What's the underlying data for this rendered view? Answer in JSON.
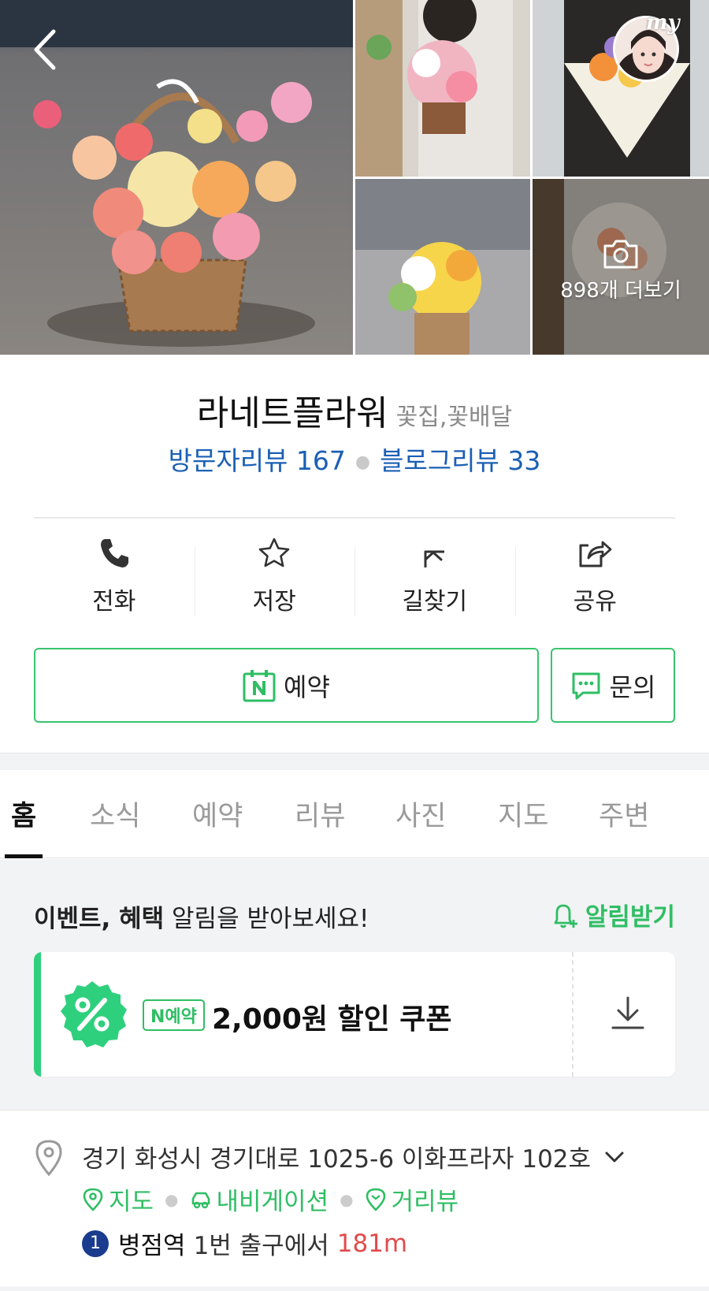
{
  "photos": {
    "more_label": "898개 더보기",
    "avatar_badge": "my"
  },
  "place": {
    "name": "라네트플라워",
    "category": "꽃집,꽃배달",
    "visitor_reviews": "방문자리뷰 167",
    "blog_reviews": "블로그리뷰 33"
  },
  "actions": [
    {
      "label": "전화",
      "icon": "phone-icon"
    },
    {
      "label": "저장",
      "icon": "star-icon"
    },
    {
      "label": "길찾기",
      "icon": "directions-icon"
    },
    {
      "label": "공유",
      "icon": "share-icon"
    }
  ],
  "buttons": {
    "reserve": "예약",
    "inquiry": "문의"
  },
  "tabs": [
    "홈",
    "소식",
    "예약",
    "리뷰",
    "사진",
    "지도",
    "주변"
  ],
  "active_tab": "홈",
  "event": {
    "title_bold": "이벤트, 혜택",
    "title_rest": " 알림을 받아보세요!",
    "notify_label": "알림받기",
    "coupon_badge": "N예약",
    "coupon_text": "2,000원 할인 쿠폰"
  },
  "address": {
    "text": "경기 화성시 경기대로 1025-6 이화프라자 102호",
    "links": [
      "지도",
      "내비게이션",
      "거리뷰"
    ],
    "station_number": "1",
    "station_name": "병점역",
    "station_exit": "1번 출구에서",
    "station_distance": "181m"
  },
  "colors": {
    "accent_green": "#2fbe64",
    "link_blue": "#1a5fb4",
    "distance_red": "#e14b4b",
    "subway_line_1": "#1a3c8f"
  }
}
